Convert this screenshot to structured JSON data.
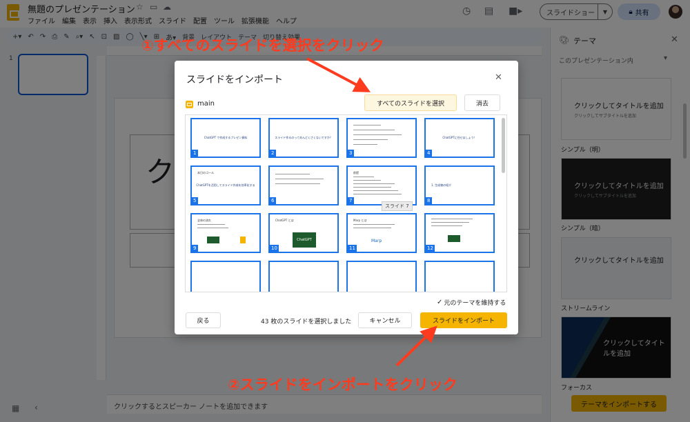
{
  "app": {
    "doc_title": "無題のプレゼンテーション",
    "menu": [
      "ファイル",
      "編集",
      "表示",
      "挿入",
      "表示形式",
      "スライド",
      "配置",
      "ツール",
      "拡張機能",
      "ヘルプ"
    ],
    "slideshow_label": "スライドショー",
    "share_label": "共有"
  },
  "toolbar": {
    "texts": [
      "背景",
      "レイアウト",
      "テーマ",
      "切り替え効果"
    ]
  },
  "filmstrip": {
    "slide_number": "1"
  },
  "canvas": {
    "title_text": "ク"
  },
  "notes": {
    "placeholder": "クリックするとスピーカー ノートを追加できます"
  },
  "theme_panel": {
    "title": "テーマ",
    "section": "このプレゼンテーション内",
    "themes": [
      {
        "title": "クリックしてタイトルを追加",
        "subtitle": "クリックしてサブタイトルを追加",
        "name": "シンプル（明）"
      },
      {
        "title": "クリックしてタイトルを追加",
        "subtitle": "クリックしてサブタイトルを追加",
        "name": "シンプル（暗）"
      },
      {
        "title": "クリックしてタイトルを追加",
        "subtitle": "",
        "name": "ストリームライン"
      },
      {
        "title": "クリックしてタイトルを追加",
        "subtitle": "",
        "name": "フォーカス"
      }
    ],
    "import_label": "テーマをインポートする"
  },
  "dialog": {
    "title": "スライドをインポート",
    "file_name": "main",
    "select_all_label": "すべてのスライドを選択",
    "clear_label": "消去",
    "tooltip": "スライド 7",
    "keep_theme_label": "元のテーマを維持する",
    "back_label": "戻る",
    "selected_count": "43 枚のスライドを選択しました",
    "cancel_label": "キャンセル",
    "import_label": "スライドをインポート",
    "slides": [
      {
        "num": "1",
        "caption": "ChatGPT で作成するプレゼン資料"
      },
      {
        "num": "2",
        "caption": "スライド作るのってめんどくさくないですか？"
      },
      {
        "num": "3",
        "caption": ""
      },
      {
        "num": "4",
        "caption": "ChatGPTに任せましょう！"
      },
      {
        "num": "5",
        "caption": "ChatGPTを活用してスライド作成を効率化する"
      },
      {
        "num": "6",
        "caption": ""
      },
      {
        "num": "7",
        "caption": ""
      },
      {
        "num": "8",
        "caption": "1. 生成物の紹介"
      },
      {
        "num": "9",
        "caption": ""
      },
      {
        "num": "10",
        "caption": ""
      },
      {
        "num": "11",
        "caption": ""
      },
      {
        "num": "12",
        "caption": ""
      },
      {
        "num": "",
        "caption": ""
      },
      {
        "num": "",
        "caption": ""
      },
      {
        "num": "",
        "caption": ""
      },
      {
        "num": "",
        "caption": ""
      }
    ],
    "slide_texts": {
      "s5_heading": "本日のゴール",
      "s7_heading": "前提",
      "s9_heading": "全体の流れ",
      "s9_mid": "ChatGPT",
      "s10_heading": "ChatGPT とは",
      "s10_logo": "ChatGPT",
      "s11_heading": "Marp とは",
      "s11_logo": "Marp"
    }
  },
  "annotations": {
    "step1": "①すべてのスライドを選択をクリック",
    "step2": "②スライドをインポートをクリック"
  }
}
